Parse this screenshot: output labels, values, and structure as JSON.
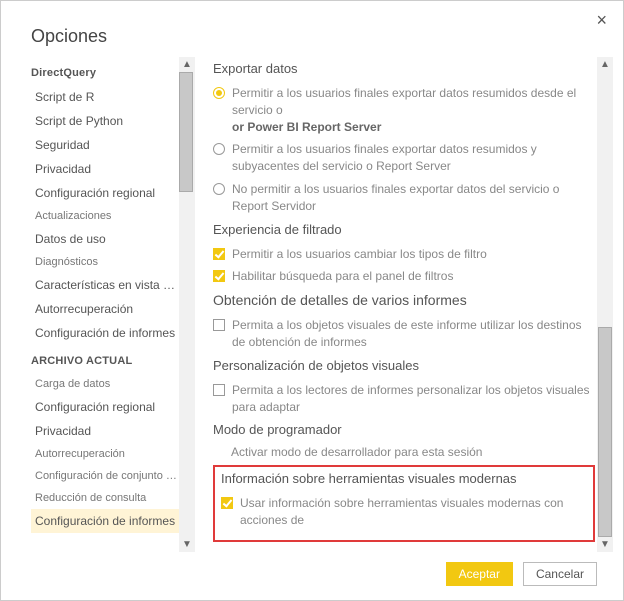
{
  "dialog": {
    "title": "Opciones",
    "close_label": "×"
  },
  "sidebar": {
    "group_global": "DirectQuery",
    "group_file": "ARCHIVO ACTUAL",
    "items_global": [
      {
        "label": "Script de R"
      },
      {
        "label": "Script de Python"
      },
      {
        "label": "Seguridad"
      },
      {
        "label": "Privacidad"
      },
      {
        "label": "Configuración regional"
      },
      {
        "label": "Actualizaciones",
        "small": true
      },
      {
        "label": "Datos de uso"
      },
      {
        "label": "Diagnósticos",
        "small": true
      },
      {
        "label": "Características en vista previa"
      },
      {
        "label": "Autorrecuperación"
      },
      {
        "label": "Configuración de informes"
      }
    ],
    "items_file": [
      {
        "label": "Carga de datos",
        "small": true
      },
      {
        "label": "Configuración regional"
      },
      {
        "label": "Privacidad"
      },
      {
        "label": "Autorrecuperación",
        "small": true
      },
      {
        "label": "Configuración de conjunto de datos publicada",
        "small": true
      },
      {
        "label": "Reducción de consulta",
        "small": true
      },
      {
        "label": "Configuración de informes",
        "active": true
      }
    ]
  },
  "content": {
    "export": {
      "title": "Exportar datos",
      "opt1_pre": "Permitir a los usuarios finales exportar datos resumidos desde el servicio o",
      "opt1_bold": "or Power BI Report Server",
      "opt2": "Permitir a los usuarios finales exportar datos resumidos y subyacentes del servicio o Report Server",
      "opt3": "No permitir a los usuarios finales exportar datos del servicio o Report Servidor"
    },
    "filter": {
      "title": "Experiencia de filtrado",
      "chk1": "Permitir a los usuarios cambiar los tipos de filtro",
      "chk2": "Habilitar búsqueda para el panel de filtros"
    },
    "crossreport": {
      "title": "Obtención de detalles de varios informes",
      "chk": "Permita a los objetos visuales de este informe utilizar los destinos de obtención de informes"
    },
    "personalize": {
      "title": "Personalización de objetos visuales",
      "chk": "Permita a los lectores de informes personalizar los objetos visuales para adaptar"
    },
    "devmode": {
      "title": "Modo de programador",
      "activate": "Activar modo de desarrollador para esta sesión"
    },
    "modern_tooltips": {
      "title": "Información sobre herramientas visuales modernas",
      "chk": "Usar información sobre herramientas visuales modernas con acciones de"
    }
  },
  "footer": {
    "ok": "Aceptar",
    "cancel": "Cancelar"
  }
}
